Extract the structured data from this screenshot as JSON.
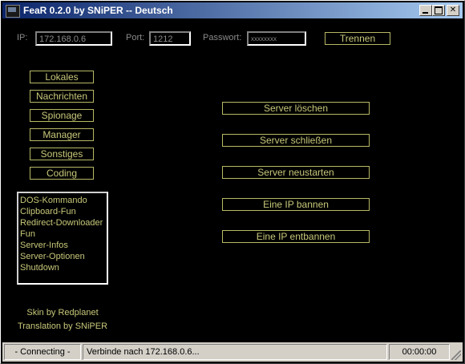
{
  "window": {
    "title": "FeaR 0.2.0 by SNiPER -- Deutsch"
  },
  "connection": {
    "ip_label": "IP:",
    "ip_value": "172.168.0.6",
    "port_label": "Port:",
    "port_value": "1212",
    "password_label": "Passwort:",
    "password_value": "xxxxxxxx",
    "disconnect_label": "Trennen"
  },
  "sidebar": {
    "items": [
      {
        "label": "Lokales"
      },
      {
        "label": "Nachrichten"
      },
      {
        "label": "Spionage"
      },
      {
        "label": "Manager"
      },
      {
        "label": "Sonstiges"
      },
      {
        "label": "Coding"
      }
    ],
    "list": [
      "DOS-Kommando",
      "Clipboard-Fun",
      "Redirect-Downloader",
      "Fun",
      "Server-Infos",
      "Server-Optionen",
      "Shutdown"
    ],
    "credits": [
      "Skin by Redplanet",
      "Translation by SNiPER"
    ]
  },
  "actions": [
    {
      "label": "Server löschen"
    },
    {
      "label": "Server schließen"
    },
    {
      "label": "Server neustarten"
    },
    {
      "label": "Eine IP bannen"
    },
    {
      "label": "Eine IP entbannen"
    }
  ],
  "status": {
    "state": "- Connecting -",
    "message": "Verbinde nach 172.168.0.6...",
    "timer": "00:00:00"
  },
  "colors": {
    "accent": "#c7c87a",
    "background": "#000000",
    "titlebar": "#0a246a"
  }
}
